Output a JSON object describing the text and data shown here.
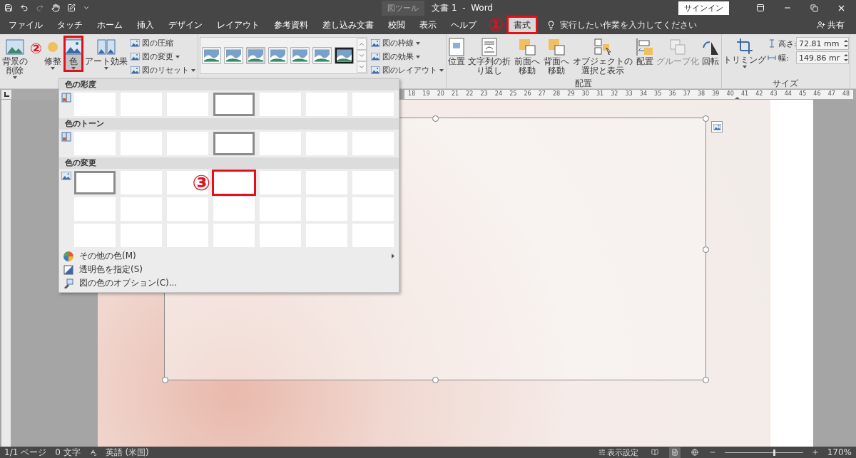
{
  "title_bar": {
    "context_label": "図ツール",
    "title": "文書 1  -  Word",
    "sign_in": "サインイン"
  },
  "tabs": [
    {
      "label": "ファイル",
      "selected": false,
      "highlighted": false
    },
    {
      "label": "タッチ",
      "selected": false,
      "highlighted": false
    },
    {
      "label": "ホーム",
      "selected": false,
      "highlighted": false
    },
    {
      "label": "挿入",
      "selected": false,
      "highlighted": false
    },
    {
      "label": "デザイン",
      "selected": false,
      "highlighted": false
    },
    {
      "label": "レイアウト",
      "selected": false,
      "highlighted": false
    },
    {
      "label": "参考資料",
      "selected": false,
      "highlighted": false
    },
    {
      "label": "差し込み文書",
      "selected": false,
      "highlighted": false
    },
    {
      "label": "校閲",
      "selected": false,
      "highlighted": false
    },
    {
      "label": "表示",
      "selected": false,
      "highlighted": false
    },
    {
      "label": "ヘルプ",
      "selected": false,
      "highlighted": false
    },
    {
      "label": "書式",
      "selected": true,
      "highlighted": true,
      "callout": "①"
    }
  ],
  "tell_me": {
    "text": "実行したい作業を入力してください"
  },
  "share": "共有",
  "ribbon": {
    "adjust": {
      "large_buttons": [
        {
          "label": "背景の削除",
          "kind": "background",
          "selected": false,
          "highlighted": false
        },
        {
          "label": "修整",
          "kind": "corrections",
          "selected": false,
          "highlighted": false,
          "callout": "②"
        },
        {
          "label": "色",
          "kind": "color",
          "selected": true,
          "highlighted": true
        },
        {
          "label": "アート効果",
          "kind": "artistic",
          "selected": false,
          "highlighted": false
        }
      ],
      "small_buttons": [
        {
          "label": "図の圧縮",
          "has_menu": false
        },
        {
          "label": "図の変更",
          "has_menu": true
        },
        {
          "label": "図のリセット",
          "has_menu": true
        }
      ]
    },
    "style_buttons": [
      {
        "label": "図の枠線",
        "has_menu": true
      },
      {
        "label": "図の効果",
        "has_menu": true
      },
      {
        "label": "図のレイアウト",
        "has_menu": true
      }
    ],
    "arrange": {
      "label": "配置",
      "buttons": [
        {
          "label": "位置",
          "kind": "position",
          "disabled": false
        },
        {
          "label": "文字列の折り返し",
          "kind": "wrap",
          "disabled": false
        },
        {
          "label": "前面へ移動",
          "kind": "forward",
          "disabled": false
        },
        {
          "label": "背面へ移動",
          "kind": "backward",
          "disabled": false
        },
        {
          "label": "オブジェクトの選択と表示",
          "kind": "selection",
          "disabled": false
        },
        {
          "label": "配置",
          "kind": "align",
          "disabled": false
        },
        {
          "label": "グループ化",
          "kind": "group",
          "disabled": true
        },
        {
          "label": "回転",
          "kind": "rotate",
          "disabled": false
        }
      ]
    },
    "size": {
      "label": "サイズ",
      "crop": "トリミング",
      "fields": [
        {
          "label": "高さ:",
          "value": "72.81 mm",
          "kind": "height"
        },
        {
          "label": "幅:",
          "value": "149.86 mr",
          "kind": "width"
        }
      ]
    }
  },
  "ruler": {
    "numbers": [
      "18",
      "19",
      "20",
      "21",
      "22",
      "23",
      "24",
      "25",
      "26",
      "27",
      "28",
      "29",
      "30",
      "31",
      "32",
      "33",
      "34",
      "35",
      "36",
      "37",
      "38",
      "39",
      "40",
      "41",
      "42",
      "43",
      "44",
      "45",
      "46",
      "47",
      "48"
    ]
  },
  "color_menu": {
    "sections": [
      {
        "title": "色の彩度",
        "thumbnails": [
          {
            "selected": false,
            "highlighted": false
          },
          {
            "selected": false,
            "highlighted": false
          },
          {
            "selected": false,
            "highlighted": false
          },
          {
            "selected": true,
            "highlighted": false
          },
          {
            "selected": false,
            "highlighted": false
          },
          {
            "selected": false,
            "highlighted": false
          },
          {
            "selected": false,
            "highlighted": false
          }
        ]
      },
      {
        "title": "色のトーン",
        "thumbnails": [
          {
            "selected": false,
            "highlighted": false
          },
          {
            "selected": false,
            "highlighted": false
          },
          {
            "selected": false,
            "highlighted": false
          },
          {
            "selected": true,
            "highlighted": false
          },
          {
            "selected": false,
            "highlighted": false
          },
          {
            "selected": false,
            "highlighted": false
          },
          {
            "selected": false,
            "highlighted": false
          }
        ]
      },
      {
        "title": "色の変更",
        "thumbnails": [
          {
            "selected": true,
            "highlighted": false
          },
          {
            "selected": false,
            "highlighted": false
          },
          {
            "selected": false,
            "highlighted": false
          },
          {
            "selected": false,
            "highlighted": true,
            "callout": "③"
          },
          {
            "selected": false,
            "highlighted": false
          },
          {
            "selected": false,
            "highlighted": false
          },
          {
            "selected": false,
            "highlighted": false
          },
          {
            "selected": false,
            "highlighted": false
          },
          {
            "selected": false,
            "highlighted": false
          },
          {
            "selected": false,
            "highlighted": false
          },
          {
            "selected": false,
            "highlighted": false
          },
          {
            "selected": false,
            "highlighted": false
          },
          {
            "selected": false,
            "highlighted": false
          },
          {
            "selected": false,
            "highlighted": false
          },
          {
            "selected": false,
            "highlighted": false
          },
          {
            "selected": false,
            "highlighted": false
          },
          {
            "selected": false,
            "highlighted": false
          },
          {
            "selected": false,
            "highlighted": false
          },
          {
            "selected": false,
            "highlighted": false
          },
          {
            "selected": false,
            "highlighted": false
          },
          {
            "selected": false,
            "highlighted": false
          }
        ]
      }
    ],
    "items": [
      {
        "label": "その他の色(M)",
        "kind": "palette",
        "has_submenu": true
      },
      {
        "label": "透明色を指定(S)",
        "kind": "transparent",
        "has_submenu": false
      },
      {
        "label": "図の色のオプション(C)...",
        "kind": "options",
        "has_submenu": false
      }
    ]
  },
  "status_bar": {
    "page": "1/1 ページ",
    "words": "0 文字",
    "language": "英語 (米国)",
    "display_settings": "表示設定",
    "views": [
      {
        "kind": "read",
        "selected": false
      },
      {
        "kind": "print",
        "selected": true
      },
      {
        "kind": "web",
        "selected": false
      }
    ],
    "zoom": {
      "level": 0.62,
      "label": "170%"
    }
  }
}
